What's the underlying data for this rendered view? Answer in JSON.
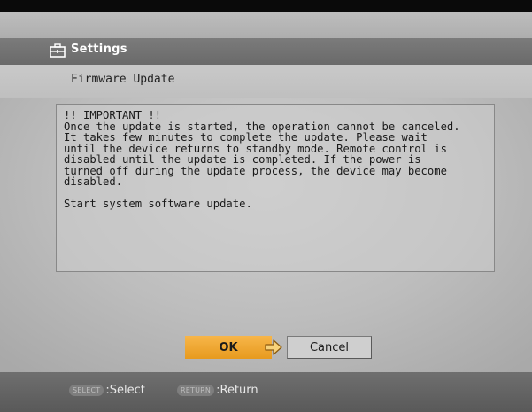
{
  "header": {
    "title": "Settings",
    "subtitle": "Firmware Update"
  },
  "dialog": {
    "heading": "!! IMPORTANT !!",
    "body": "Once the update is started, the operation cannot be canceled.\nIt takes few minutes to complete the update. Please wait\nuntil the device returns to standby mode. Remote control is\ndisabled until the update is completed. If the power is\nturned off during the update process, the device may become\ndisabled.",
    "prompt": "Start system software update."
  },
  "buttons": {
    "ok_label": "OK",
    "cancel_label": "Cancel"
  },
  "footer": {
    "select_key": "SELECT",
    "select_label": ":Select",
    "return_key": "RETURN",
    "return_label": ":Return"
  },
  "icons": {
    "title": "settings-toolbox-icon",
    "pointer": "hand-pointer-icon"
  },
  "colors": {
    "accent": "#f0a830",
    "title_bar": "#707070",
    "footer": "#626262"
  }
}
